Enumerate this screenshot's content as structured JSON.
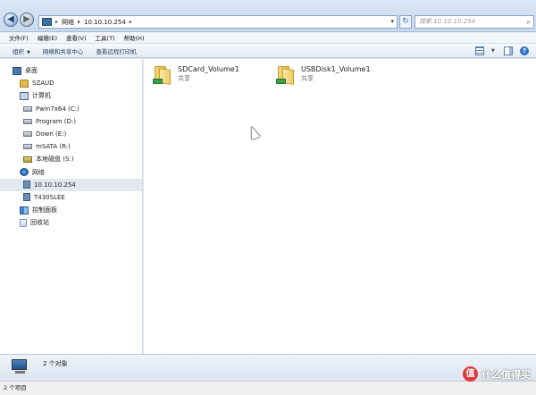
{
  "address": {
    "back_label": "◀",
    "forward_label": "▶",
    "crumbs": [
      "网络",
      "10.10.10.254"
    ],
    "refresh_label": "↻",
    "search_placeholder": "搜索 10.10.10.254"
  },
  "menubar": [
    "文件(F)",
    "编辑(E)",
    "查看(V)",
    "工具(T)",
    "帮助(H)"
  ],
  "commandbar": {
    "organize": "组织",
    "network_center": "网络和共享中心",
    "remote_printers": "查看远程打印机"
  },
  "sidebar": {
    "items": [
      {
        "label": "桌面",
        "icon": "desktop-icon"
      },
      {
        "label": "SZAUD",
        "icon": "user-folder-icon"
      },
      {
        "label": "计算机",
        "icon": "computer-icon"
      },
      {
        "label": "Pwin7x64 (C:)",
        "icon": "drive-icon"
      },
      {
        "label": "Program (D:)",
        "icon": "drive-icon"
      },
      {
        "label": "Down (E:)",
        "icon": "drive-icon"
      },
      {
        "label": "mSATA (R:)",
        "icon": "drive-icon"
      },
      {
        "label": "本地磁盘 (S:)",
        "icon": "network-drive-icon"
      },
      {
        "label": "网络",
        "icon": "network-icon"
      },
      {
        "label": "10.10.10.254",
        "icon": "server-icon",
        "selected": true
      },
      {
        "label": "T430SLEE",
        "icon": "server-icon"
      },
      {
        "label": "控制面板",
        "icon": "control-panel-icon"
      },
      {
        "label": "回收站",
        "icon": "recycle-bin-icon"
      }
    ]
  },
  "content": {
    "items": [
      {
        "name": "SDCard_Volume1",
        "type": "共享",
        "icon": "shared-folder-icon"
      },
      {
        "name": "USBDisk1_Volume1",
        "type": "共享",
        "icon": "shared-folder-icon"
      }
    ]
  },
  "details": {
    "count": "2 个对象"
  },
  "status": {
    "text": "2 个项目"
  },
  "watermark": {
    "badge": "值",
    "text": "什么值得买"
  }
}
